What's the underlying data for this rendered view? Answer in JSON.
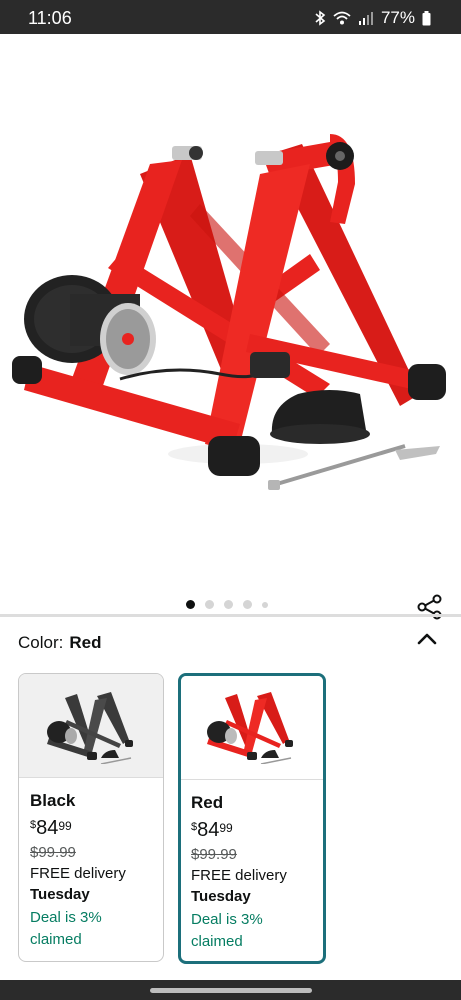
{
  "status_bar": {
    "time": "11:06",
    "battery": "77%",
    "icons": [
      "bluetooth-icon",
      "wifi-icon",
      "signal-icon",
      "battery-icon"
    ]
  },
  "gallery": {
    "image": "product-image",
    "dots_total": 5,
    "active_index": 0,
    "share_icon": "share-icon"
  },
  "color_selector": {
    "label": "Color:",
    "selected": "Red",
    "collapse_icon": "chevron-up-icon",
    "options": [
      {
        "name": "Black",
        "currency": "$",
        "price_whole": "84",
        "price_cents": "99",
        "list_price": "$99.99",
        "delivery": "FREE delivery",
        "delivery_day": "Tuesday",
        "deal": "Deal is 3% claimed",
        "frame_color": "#3a3a3a",
        "selected": false
      },
      {
        "name": "Red",
        "currency": "$",
        "price_whole": "84",
        "price_cents": "99",
        "list_price": "$99.99",
        "delivery": "FREE delivery",
        "delivery_day": "Tuesday",
        "deal": "Deal is 3% claimed",
        "frame_color": "#e8231f",
        "selected": true
      }
    ]
  },
  "colors": {
    "accent_selected_border": "#1c6f7b",
    "deal_green": "#067d62",
    "product_red": "#e8231f"
  }
}
